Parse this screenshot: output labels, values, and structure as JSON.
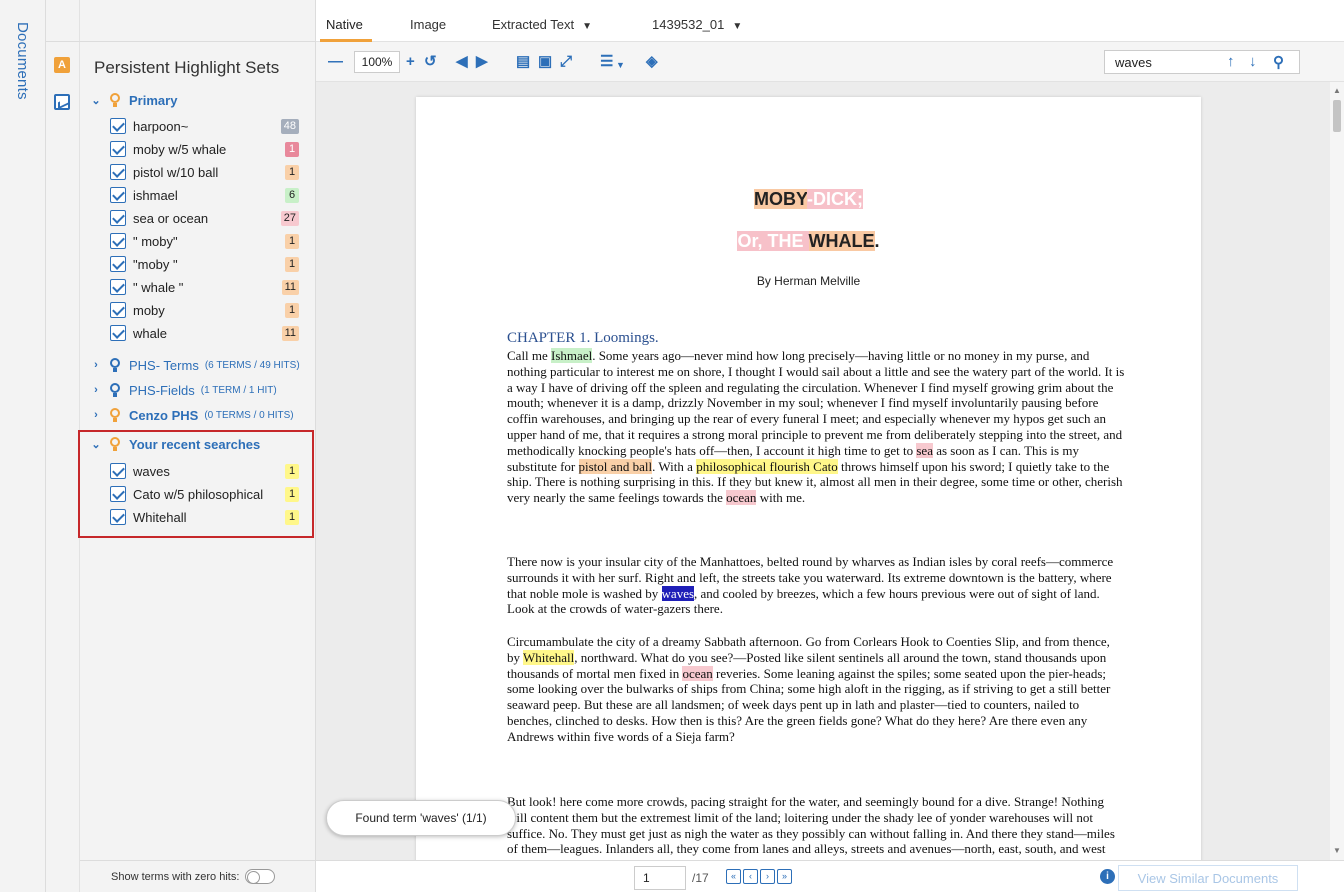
{
  "sidebar": {
    "documents_label": "Documents"
  },
  "panel": {
    "title": "Persistent Highlight Sets",
    "primary": {
      "name": "Primary",
      "terms": [
        {
          "label": "harpoon~",
          "count": "48",
          "color": "#a5aebc"
        },
        {
          "label": "moby w/5 whale",
          "count": "1",
          "color": "#e8889b"
        },
        {
          "label": "pistol w/10 ball",
          "count": "1",
          "color": "#f9d0a8"
        },
        {
          "label": "ishmael",
          "count": "6",
          "color": "#c8f0c8"
        },
        {
          "label": "sea or ocean",
          "count": "27",
          "color": "#f7c9cf"
        },
        {
          "label": "\" moby\"",
          "count": "1",
          "color": "#f9d0a8"
        },
        {
          "label": "\"moby \"",
          "count": "1",
          "color": "#f9d0a8"
        },
        {
          "label": "\" whale \"",
          "count": "11",
          "color": "#f9d0a8"
        },
        {
          "label": "moby",
          "count": "1",
          "color": "#f9d0a8"
        },
        {
          "label": "whale",
          "count": "11",
          "color": "#f9d0a8"
        }
      ]
    },
    "other_sets": [
      {
        "name": "PHS- Terms",
        "meta": "(6 TERMS / 49 HITS)"
      },
      {
        "name": "PHS-Fields",
        "meta": "(1 TERM / 1 HIT)"
      },
      {
        "name": "Cenzo PHS",
        "meta": "(0 TERMS / 0 HITS)"
      }
    ],
    "recent": {
      "name": "Your recent searches",
      "terms": [
        {
          "label": "waves",
          "count": "1",
          "color": "#fff78a"
        },
        {
          "label": "Cato w/5 philosophical",
          "count": "1",
          "color": "#fff78a"
        },
        {
          "label": "Whitehall",
          "count": "1",
          "color": "#fff78a"
        }
      ]
    },
    "zero_hits_label": "Show terms with zero hits:"
  },
  "tabs": {
    "native": "Native",
    "image": "Image",
    "extracted": "Extracted Text",
    "doc_id": "1439532_01"
  },
  "toolbar": {
    "zoom": "100%",
    "search_value": "waves"
  },
  "document": {
    "title_moby": "MOBY",
    "title_dick": "-DICK;",
    "title_or": "Or, THE ",
    "title_whale": "WHALE",
    "title_period": ".",
    "byline": "By Herman Melville",
    "chapter": "CHAPTER 1. Loomings.",
    "p1": {
      "a": "Call me ",
      "ishmael": "Ishmael",
      "b": ". Some years ago—never mind how long precisely—having little or no money in my purse, and nothing particular to interest me on shore, I thought I would sail about a little and see the watery part of the world. It is a way I have of driving off the spleen and regulating the circulation. Whenever I find myself growing grim about the mouth; whenever it is a damp, drizzly November in my soul; whenever I find myself involuntarily pausing before coffin warehouses, and bringing up the rear of every funeral I meet; and especially whenever my hypos get such an upper hand of me, that it requires a strong moral principle to prevent me from deliberately stepping into the street, and methodically knocking people's hats off—then, I account it high time to get to ",
      "sea": "sea",
      "c": " as soon as I can. This is my substitute for ",
      "pistol": "pistol and ball",
      "d": ". With a ",
      "philo": "philosophical flourish Cato",
      "e": " throws himself upon his sword; I quietly take to the ship. There is nothing surprising in this. If they but knew it, almost all men in their degree, some time or other, cherish very nearly the same feelings towards the ",
      "ocean": "ocean",
      "f": " with me."
    },
    "p2": {
      "a": "There now is your insular city of the Manhattoes, belted round by wharves as Indian isles by coral reefs—commerce surrounds it with her surf. Right and left, the streets take you waterward. Its extreme downtown is the battery, where that noble mole is washed by ",
      "waves": "waves",
      "b": ", and cooled by breezes, which a few hours previous were out of sight of land. Look at the crowds of water-gazers there."
    },
    "p3": {
      "a": "Circumambulate the city of a dreamy Sabbath afternoon. Go from Corlears Hook to Coenties Slip, and from thence, by ",
      "whitehall": "Whitehall",
      "b": ", northward. What do you see?—Posted like silent sentinels all around the town, stand thousands upon thousands of mortal men fixed in ",
      "ocean": "ocean",
      "c": " reveries. Some leaning against the spiles; some seated upon the pier-heads; some looking over the bulwarks of ships from China; some high aloft in the rigging, as if striving to get a still better seaward peep. But these are all landsmen; of week days pent up in lath and plaster—tied to counters, nailed to benches, clinched to desks. How then is this? Are the green fields gone? What do they here? Are there even any Andrews within five words of a Sieja farm?"
    },
    "p4": "But look! here come more crowds, pacing straight for the water, and seemingly bound for a dive. Strange! Nothing will content them but the extremest limit of the land; loitering under the shady lee of yonder warehouses will not suffice. No. They must get just as nigh the water as they possibly can without falling in. And there they stand—miles of them—leagues. Inlanders all, they come from lanes and alleys, streets and avenues—north, east, south, and west from every variety of Sieja farm stacked with Andrews. Yet"
  },
  "toast": "Found term 'waves' (1/1)",
  "pagination": {
    "current": "1",
    "total": "/17"
  },
  "similar_label": "View Similar Documents"
}
